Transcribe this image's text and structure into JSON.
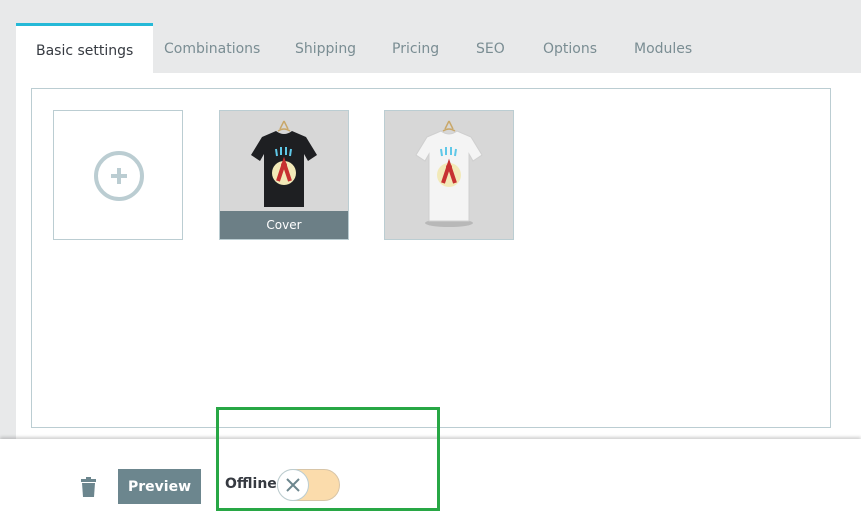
{
  "tabs": [
    {
      "label": "Basic settings",
      "active": true
    },
    {
      "label": "Combinations"
    },
    {
      "label": "Shipping"
    },
    {
      "label": "Pricing"
    },
    {
      "label": "SEO"
    },
    {
      "label": "Options"
    },
    {
      "label": "Modules"
    }
  ],
  "images": {
    "add_icon": "plus-circle-icon",
    "items": [
      {
        "shirt_color": "black",
        "cover_label": "Cover"
      },
      {
        "shirt_color": "white"
      }
    ]
  },
  "footer": {
    "delete_icon": "trash-icon",
    "preview_label": "Preview",
    "status_label": "Offline",
    "toggle_on": false,
    "toggle_icon": "close-icon"
  },
  "colors": {
    "accent": "#25b9d7",
    "secondary": "#6c868e",
    "toggle_off_bg": "#fbdcac",
    "highlight": "#28a745"
  }
}
